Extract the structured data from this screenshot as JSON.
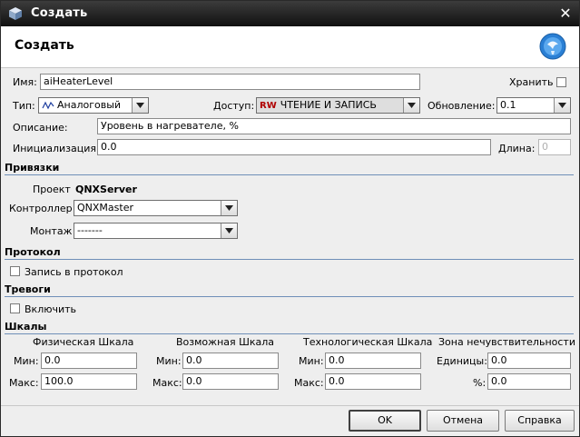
{
  "window": {
    "title": "Создать"
  },
  "header": {
    "title": "Создать"
  },
  "fields": {
    "name_label": "Имя:",
    "name_value": "aiHeaterLevel",
    "store_label": "Хранить",
    "type_label": "Тип:",
    "type_value": "Аналоговый",
    "access_label": "Доступ:",
    "access_badge": "RW",
    "access_value": "ЧТЕНИЕ И ЗАПИСЬ",
    "update_label": "Обновление:",
    "update_value": "0.1",
    "description_label": "Описание:",
    "description_value": "Уровень в нагревателе, %",
    "init_label": "Инициализация:",
    "init_value": "0.0",
    "length_label": "Длина:",
    "length_value": "0"
  },
  "bindings": {
    "section_title": "Привязки",
    "project_label": "Проект",
    "project_value": "QNXServer",
    "controller_label": "Контроллер",
    "controller_value": "QNXMaster",
    "mount_label": "Монтаж",
    "mount_value": "-------"
  },
  "protocol": {
    "section_title": "Протокол",
    "log_label": "Запись в протокол"
  },
  "alarms": {
    "section_title": "Тревоги",
    "enable_label": "Включить"
  },
  "scales": {
    "section_title": "Шкалы",
    "physical": {
      "title": "Физическая Шкала",
      "min_label": "Мин:",
      "min_value": "0.0",
      "max_label": "Макс:",
      "max_value": "100.0"
    },
    "possible": {
      "title": "Возможная Шкала",
      "min_label": "Мин:",
      "min_value": "0.0",
      "max_label": "Макс:",
      "max_value": "0.0"
    },
    "technological": {
      "title": "Технологическая Шкала",
      "min_label": "Мин:",
      "min_value": "0.0",
      "max_label": "Макс:",
      "max_value": "0.0"
    },
    "deadzone": {
      "title": "Зона нечувствительности",
      "units_label": "Единицы:",
      "units_value": "0.0",
      "percent_label": "%:",
      "percent_value": "0.0"
    }
  },
  "buttons": {
    "ok": "OK",
    "cancel": "Отмена",
    "help": "Справка"
  },
  "colors": {
    "accent_line": "#6f8fb8",
    "access_badge": "#b00000",
    "titlebar": "#1e1e1e"
  },
  "icons": {
    "app": "cube-icon",
    "close": "close-icon",
    "header": "globe-icon",
    "type": "waveform-icon"
  }
}
